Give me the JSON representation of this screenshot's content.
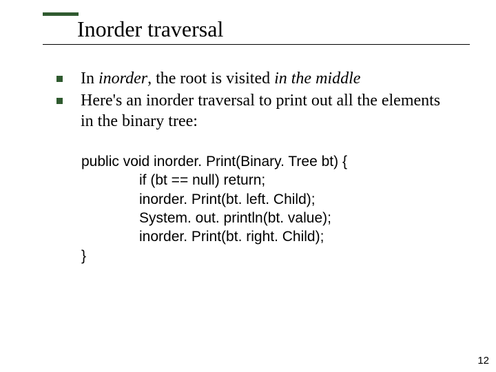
{
  "title": "Inorder traversal",
  "bullets": [
    {
      "pre": "In ",
      "em1": "inorder",
      "mid": ", the root is visited ",
      "em2": "in the middle",
      "post": ""
    },
    {
      "pre": "Here's an inorder traversal to print out all the elements in the binary tree:",
      "em1": "",
      "mid": "",
      "em2": "",
      "post": ""
    }
  ],
  "code": {
    "l1": "public void inorder. Print(Binary. Tree bt) {",
    "l2": "if (bt == null) return;",
    "l3": "inorder. Print(bt. left. Child);",
    "l4": "System. out. println(bt. value);",
    "l5": "inorder. Print(bt. right. Child);",
    "l6": "}"
  },
  "page_number": "12"
}
